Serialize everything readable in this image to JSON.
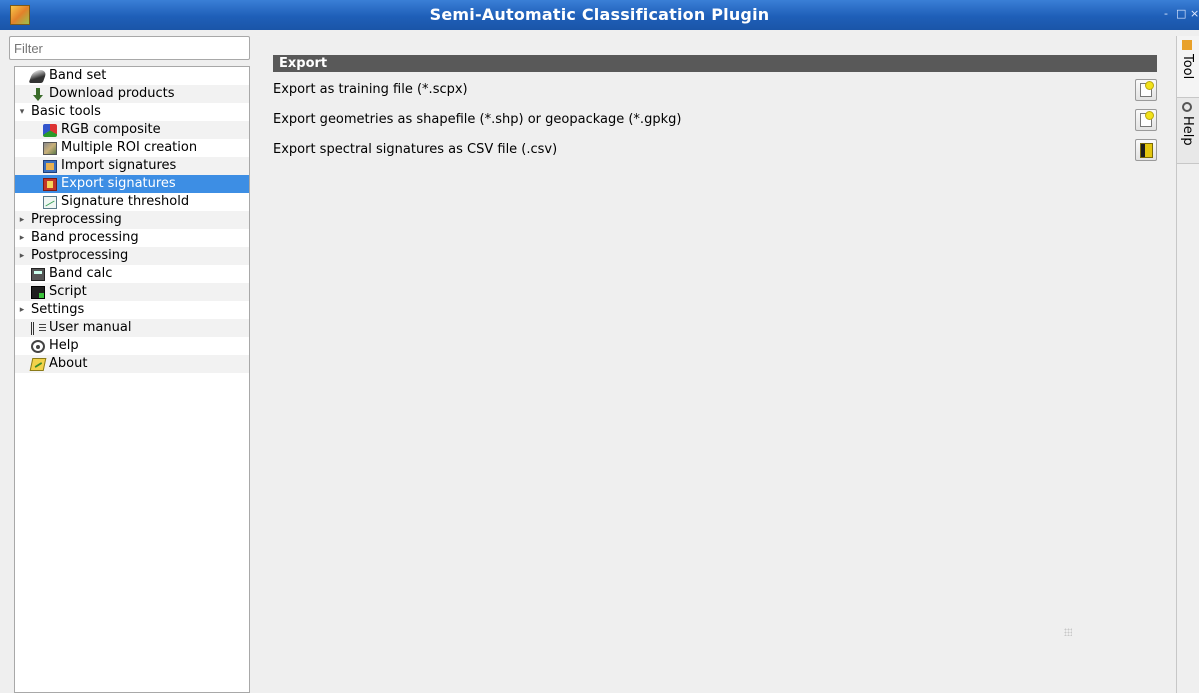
{
  "window": {
    "title": "Semi-Automatic Classification Plugin",
    "controls": [
      "-",
      "□",
      "×"
    ]
  },
  "sidebar": {
    "filter_placeholder": "Filter",
    "items": [
      {
        "label": "Band set",
        "icon": "band-set-icon",
        "level": 1
      },
      {
        "label": "Download products",
        "icon": "download-icon",
        "level": 1
      },
      {
        "label": "Basic tools",
        "expander": "expanded",
        "level": 0
      },
      {
        "label": "RGB composite",
        "icon": "rgb-composite-icon",
        "level": 2
      },
      {
        "label": "Multiple ROI creation",
        "icon": "multiple-roi-icon",
        "level": 2
      },
      {
        "label": "Import signatures",
        "icon": "import-signatures-icon",
        "level": 2
      },
      {
        "label": "Export signatures",
        "icon": "export-signatures-icon",
        "level": 2,
        "selected": true
      },
      {
        "label": "Signature threshold",
        "icon": "signature-threshold-icon",
        "level": 2
      },
      {
        "label": "Preprocessing",
        "expander": "collapsed",
        "level": 0
      },
      {
        "label": "Band processing",
        "expander": "collapsed",
        "level": 0
      },
      {
        "label": "Postprocessing",
        "expander": "collapsed",
        "level": 0
      },
      {
        "label": "Band calc",
        "icon": "band-calc-icon",
        "level": 1
      },
      {
        "label": "Script",
        "icon": "script-icon",
        "level": 1
      },
      {
        "label": "Settings",
        "expander": "collapsed",
        "level": 0
      },
      {
        "label": "User manual",
        "icon": "user-manual-icon",
        "level": 1
      },
      {
        "label": "Help",
        "icon": "help-icon",
        "level": 1
      },
      {
        "label": "About",
        "icon": "about-icon",
        "level": 1
      }
    ]
  },
  "main": {
    "section_title": "Export",
    "rows": [
      {
        "label": "Export as training file (*.scpx)",
        "button_icon": "new-file-icon"
      },
      {
        "label": "Export geometries as shapefile (*.shp) or geopackage (*.gpkg)",
        "button_icon": "new-file-icon"
      },
      {
        "label": "Export spectral signatures as CSV file (.csv)",
        "button_icon": "open-file-icon"
      }
    ]
  },
  "dock_tabs": [
    {
      "label": "Tool",
      "active": true
    },
    {
      "label": "Help",
      "active": false
    }
  ],
  "colors": {
    "titlebar": "#2a6cc6",
    "selection": "#3d8ee4",
    "section_header": "#595959",
    "background": "#efefef"
  }
}
